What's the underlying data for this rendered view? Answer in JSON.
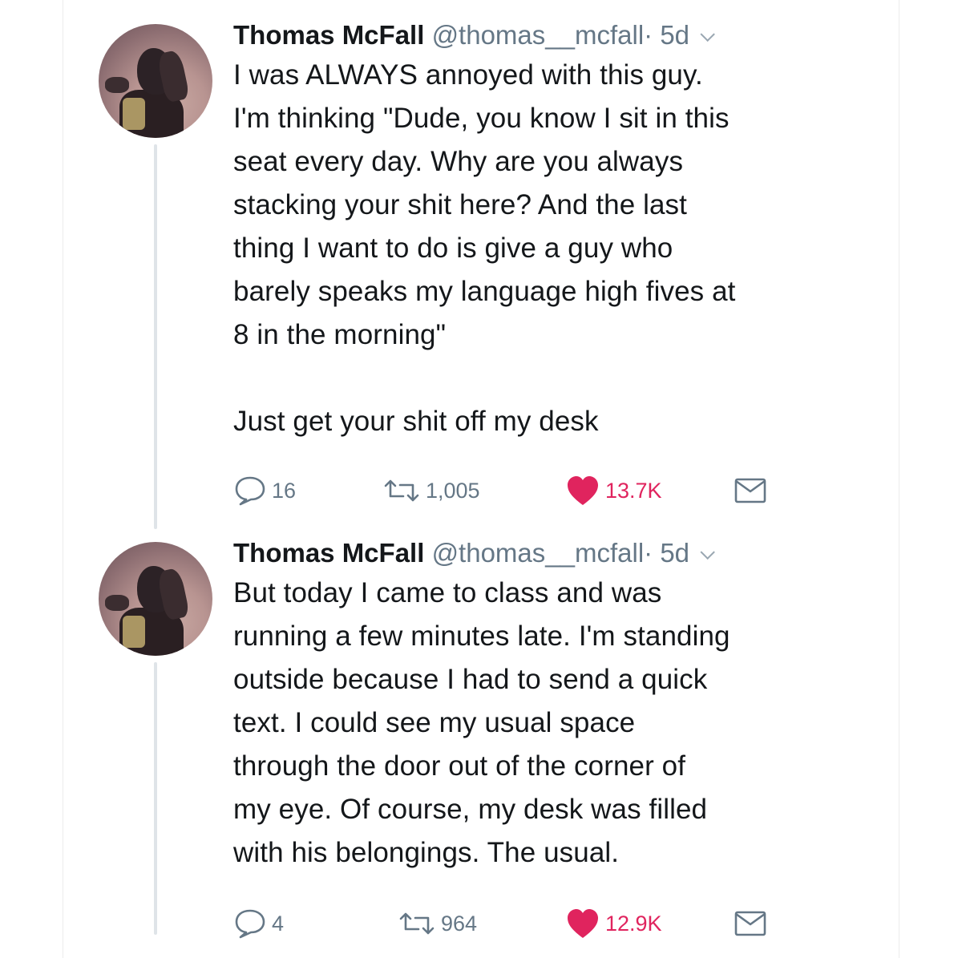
{
  "tweets": [
    {
      "display_name": "Thomas McFall",
      "handle": "@thomas__mcfall",
      "age": "· 5d",
      "text": "I was ALWAYS annoyed with this guy.\nI'm thinking \"Dude, you know I sit in this\nseat every day. Why are you always\nstacking your shit here? And the last\nthing I want to do is give a guy who\nbarely speaks my language high fives at\n8 in the morning\"\n\nJust get your shit off my desk",
      "replies": "16",
      "retweets": "1,005",
      "likes": "13.7K"
    },
    {
      "display_name": "Thomas McFall",
      "handle": "@thomas__mcfall",
      "age": "· 5d",
      "text": "But today I came to class and was\nrunning a few minutes late. I'm standing\noutside because I had to send a quick\ntext. I could see my usual space\nthrough the door out of the corner of\nmy eye. Of course, my desk was filled\nwith his belongings. The usual.",
      "replies": "4",
      "retweets": "964",
      "likes": "12.9K"
    }
  ],
  "icons": {
    "reply": "reply-icon",
    "retweet": "retweet-icon",
    "like": "heart-icon",
    "dm": "envelope-icon",
    "menu": "chevron-down-icon"
  },
  "colors": {
    "text": "#14171a",
    "meta": "#657786",
    "like": "#e0245e",
    "thread_line": "#dfe4e8"
  }
}
